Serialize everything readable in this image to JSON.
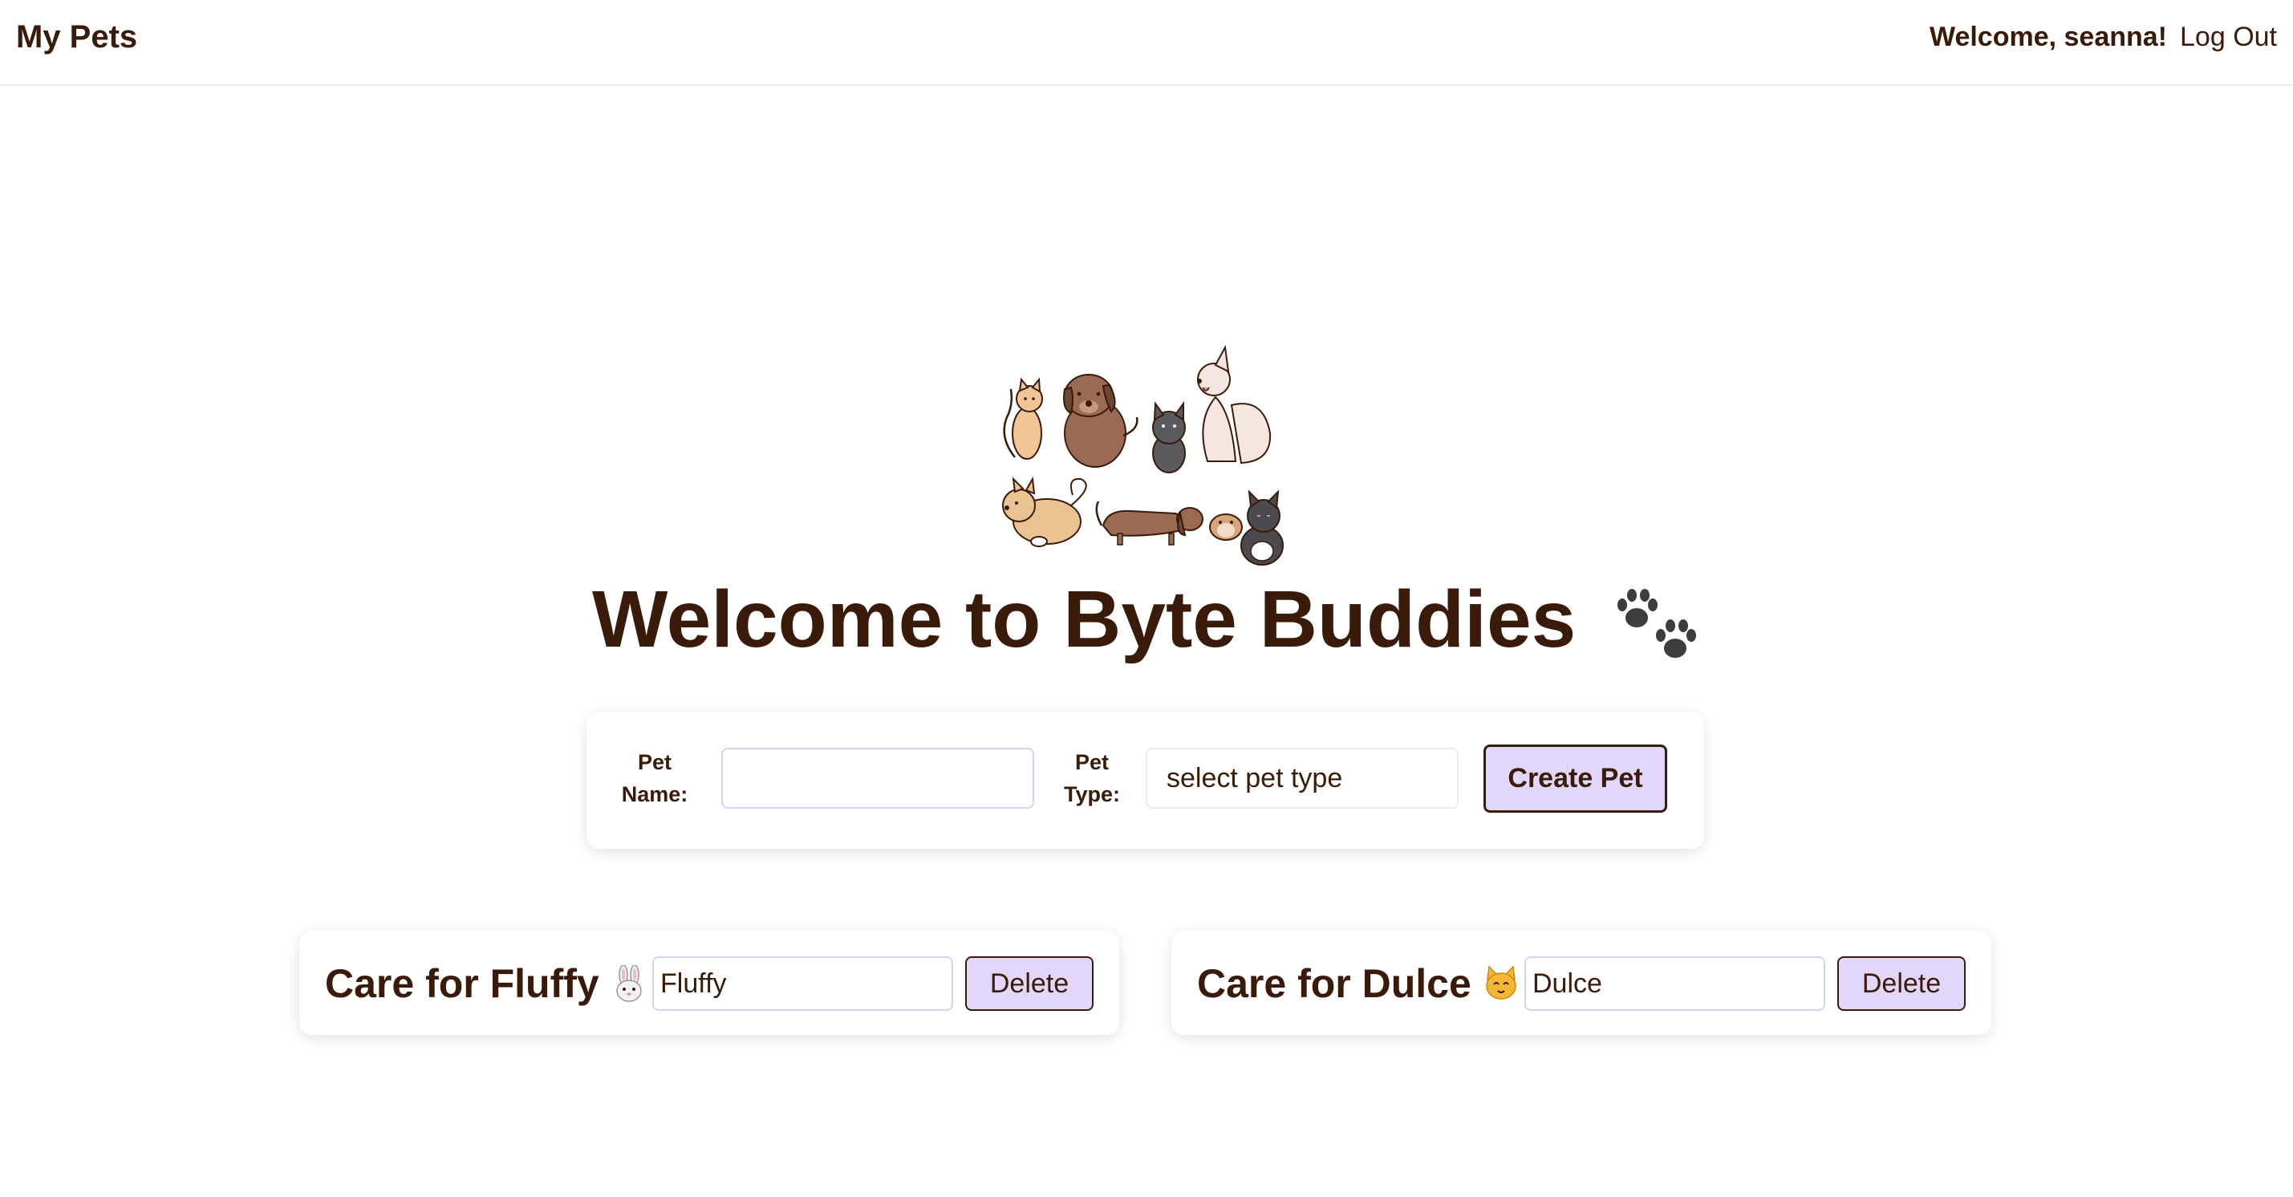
{
  "header": {
    "brand": "My Pets",
    "welcome": "Welcome, seanna!",
    "logout_label": "Log Out"
  },
  "hero": {
    "title": "Welcome to Byte Buddies",
    "title_icon": "paw-prints-icon",
    "art": "pets-group-illustration"
  },
  "create_form": {
    "name_label_line1": "Pet",
    "name_label_line2": "Name:",
    "name_value": "",
    "type_label_line1": "Pet",
    "type_label_line2": "Type:",
    "type_selected": "select pet type",
    "create_label": "Create Pet"
  },
  "pets": [
    {
      "title": "Care for Fluffy",
      "icon": "rabbit-icon",
      "name_value": "Fluffy",
      "delete_label": "Delete"
    },
    {
      "title": "Care for Dulce",
      "icon": "cat-icon",
      "name_value": "Dulce",
      "delete_label": "Delete"
    }
  ],
  "colors": {
    "text": "#3a1a08",
    "button_bg": "#e2d7fb",
    "input_border": "#d8d2f2"
  }
}
